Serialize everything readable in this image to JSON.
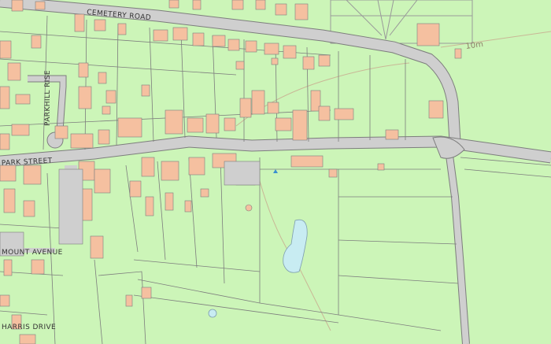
{
  "map": {
    "colors": {
      "land": "#ccf5b8",
      "building": "#f5c0a0",
      "road": "#cfcfcf",
      "water": "#c8ecf2",
      "lines": "#7d7d7d",
      "path": "#c9b796"
    },
    "labels": {
      "cemetery_road": "CEMETERY ROAD",
      "park_street": "PARK STREET",
      "parkhill_rise": "PARKHILL RISE",
      "mount_avenue": "MOUNT AVENUE",
      "harris_drive": "HARRIS DRIVE",
      "contour": "10m"
    }
  }
}
